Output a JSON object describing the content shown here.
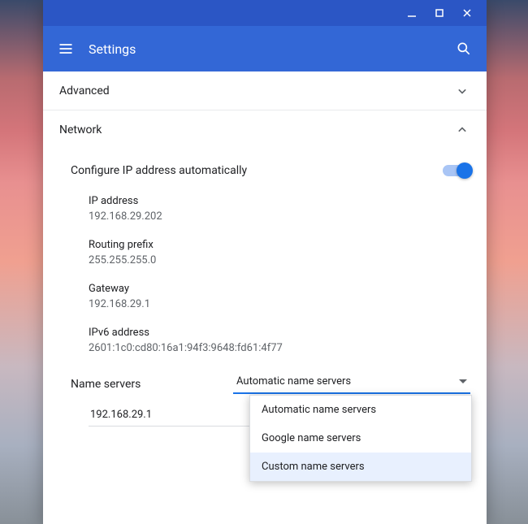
{
  "appbar": {
    "title": "Settings"
  },
  "sections": {
    "advanced": {
      "label": "Advanced"
    },
    "network": {
      "label": "Network",
      "configure_ip": "Configure IP address automatically",
      "ip_label": "IP address",
      "ip_value": "192.168.29.202",
      "prefix_label": "Routing prefix",
      "prefix_value": "255.255.255.0",
      "gateway_label": "Gateway",
      "gateway_value": "192.168.29.1",
      "ipv6_label": "IPv6 address",
      "ipv6_value": "2601:1c0:cd80:16a1:94f3:9648:fd61:4f77",
      "ns_label": "Name servers",
      "ns_selected": "Automatic name servers",
      "ns_options": {
        "auto": "Automatic name servers",
        "google": "Google name servers",
        "custom": "Custom name servers"
      },
      "ns_field_value": "192.168.29.1"
    }
  }
}
